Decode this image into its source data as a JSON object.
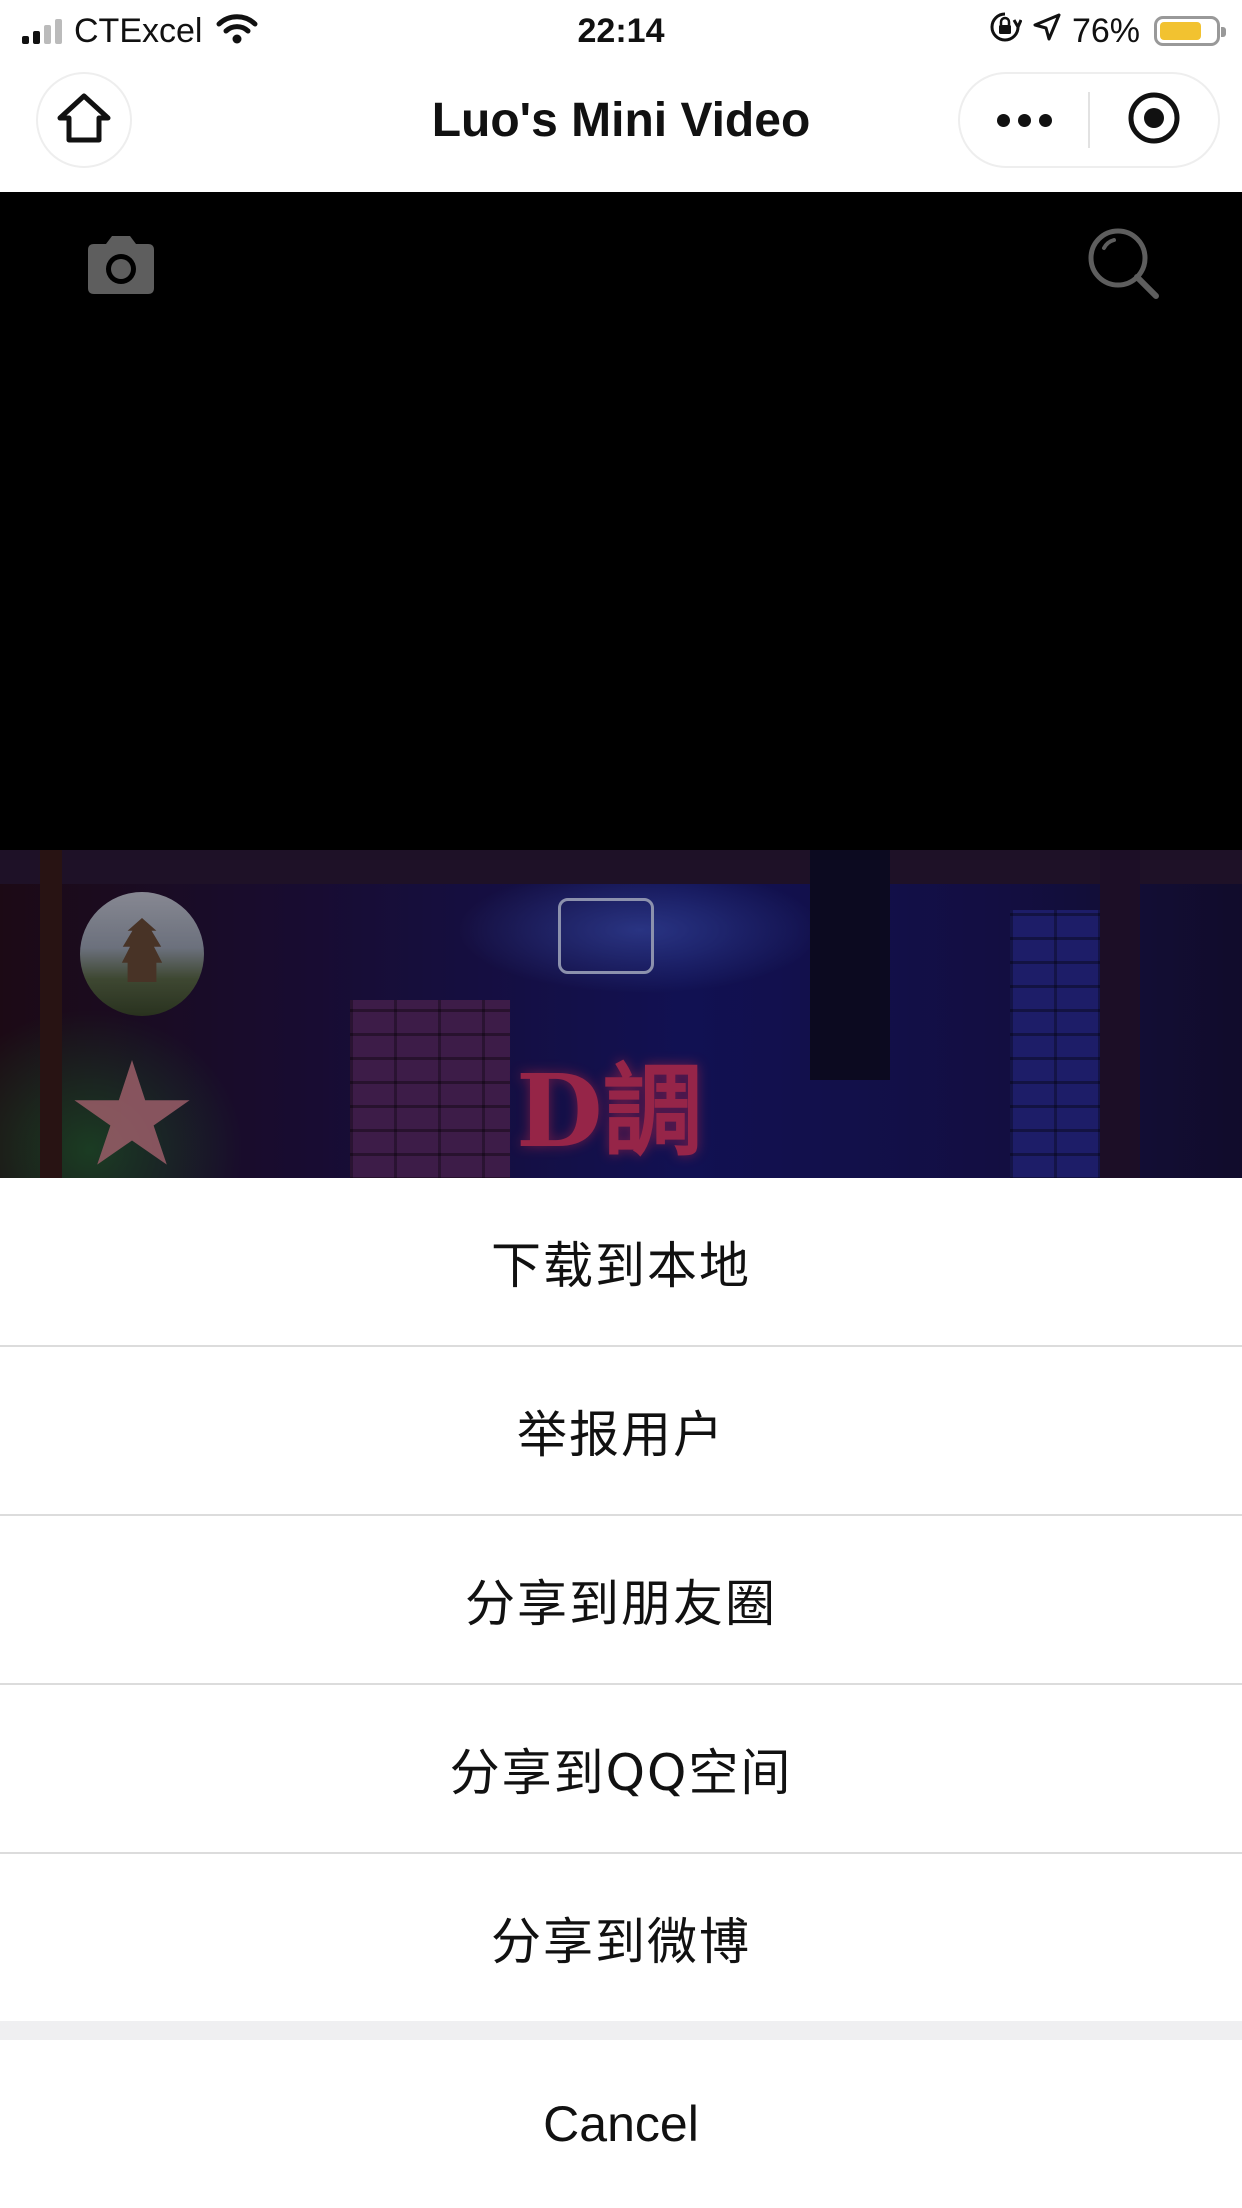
{
  "status_bar": {
    "carrier": "CTExcel",
    "time": "22:14",
    "battery_percent": "76%",
    "battery_level": 0.76,
    "icons": [
      "signal-icon",
      "wifi-icon",
      "orientation-lock-icon",
      "location-arrow-icon",
      "battery-icon"
    ]
  },
  "nav": {
    "title": "Luo's Mini Video",
    "icons": [
      "home-icon",
      "more-dots-icon",
      "close-target-icon"
    ]
  },
  "video": {
    "icons": [
      "camera-icon",
      "search-icon"
    ],
    "sign_text": "D調"
  },
  "action_sheet": {
    "items": [
      {
        "label": "下载到本地"
      },
      {
        "label": "举报用户"
      },
      {
        "label": "分享到朋友圈"
      },
      {
        "label": "分享到QQ空间"
      },
      {
        "label": "分享到微博"
      }
    ],
    "cancel_label": "Cancel"
  },
  "colors": {
    "battery": "#f2c230",
    "sheet_background": "#efeff1",
    "separator": "#dcdcdc"
  }
}
